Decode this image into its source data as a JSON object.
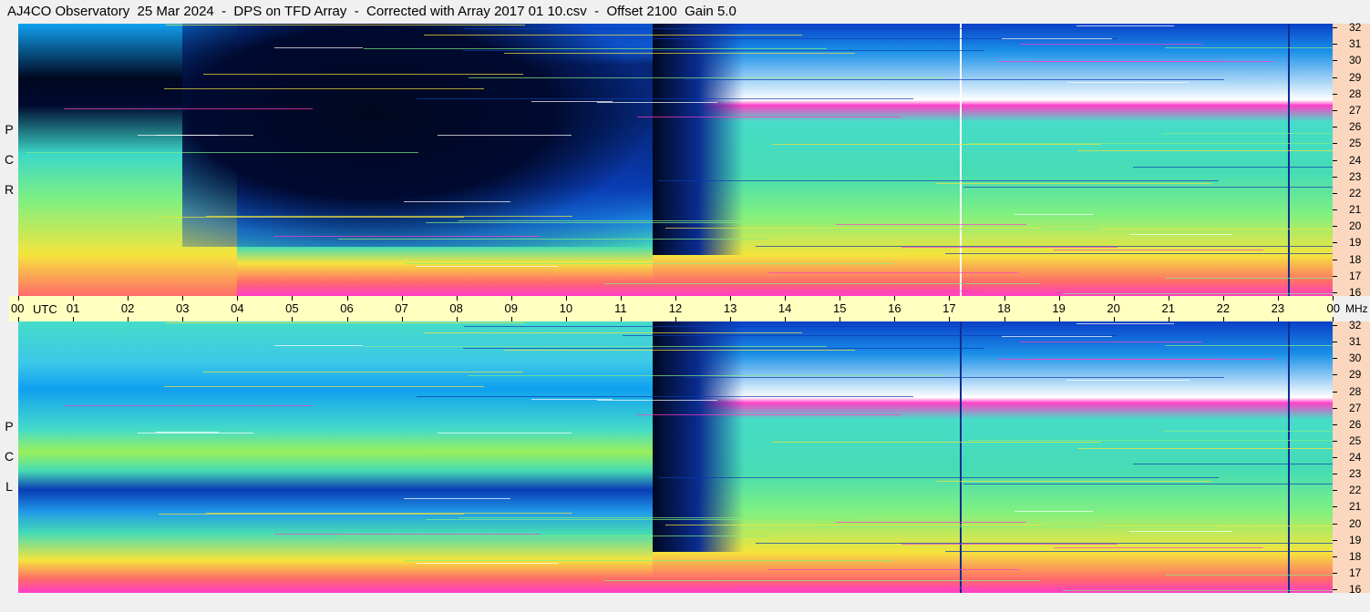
{
  "title": "AJ4CO Observatory  25 Mar 2024  -  DPS on TFD Array  -  Corrected with Array 2017 01 10.csv  -  Offset 2100  Gain 5.0",
  "panels": [
    {
      "id": "top",
      "polarization_letters": [
        "P",
        "C",
        "R"
      ]
    },
    {
      "id": "bottom",
      "polarization_letters": [
        "P",
        "C",
        "L"
      ]
    }
  ],
  "time_axis": {
    "utc_label": "UTC",
    "ticks": [
      "00",
      "01",
      "02",
      "03",
      "04",
      "05",
      "06",
      "07",
      "08",
      "09",
      "10",
      "11",
      "12",
      "13",
      "14",
      "15",
      "16",
      "17",
      "18",
      "19",
      "20",
      "21",
      "22",
      "23",
      "00"
    ]
  },
  "frequency_axis": {
    "unit": "MHz",
    "ticks": [
      "32",
      "31",
      "30",
      "29",
      "28",
      "27",
      "26",
      "25",
      "24",
      "23",
      "22",
      "21",
      "20",
      "19",
      "18",
      "17",
      "16"
    ]
  },
  "colors": {
    "background": "#f0f0f0",
    "time_axis_bg": "#ffffc0",
    "freq_axis_bg": "#fad7be",
    "spectrogram_low": "#000830",
    "spectrogram_mid": "#10c4ec",
    "spectrogram_high": "#ff3cc8"
  }
}
